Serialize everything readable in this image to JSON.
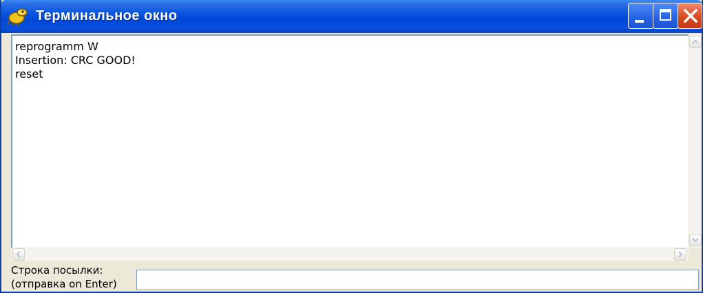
{
  "window": {
    "title": "Терминальное окно",
    "icon": "terminal-app-icon"
  },
  "titlebar_buttons": {
    "minimize": "minimize-icon",
    "maximize": "maximize-icon",
    "close": "close-icon"
  },
  "output": {
    "lines": [
      "reprogramm W",
      "Insertion: CRC GOOD!",
      "reset"
    ]
  },
  "send": {
    "label_line1": "Строка посылки:",
    "label_line2": "(отправка  on Enter)",
    "value": ""
  },
  "colors": {
    "titlebar": "#0a55e0",
    "close_button": "#d9481f",
    "window_face": "#ece9d8",
    "border": "#7f9db9"
  }
}
